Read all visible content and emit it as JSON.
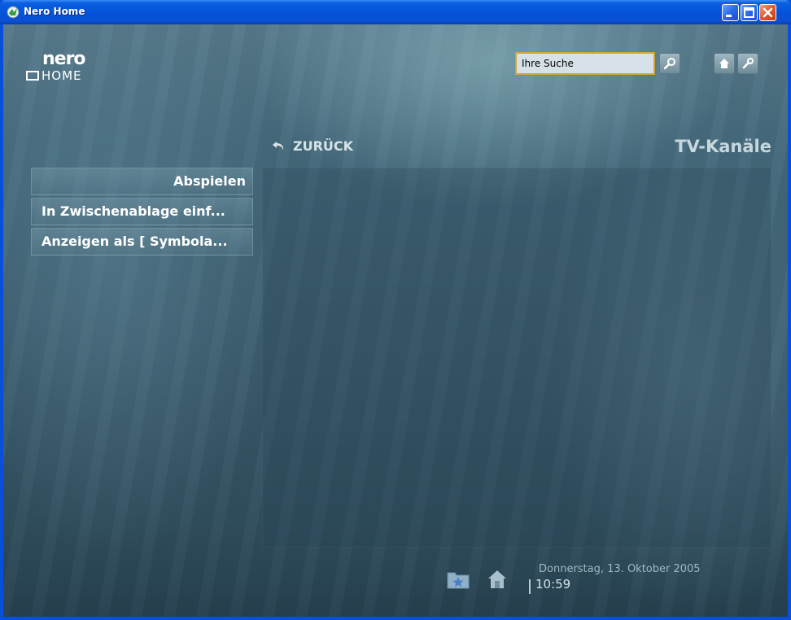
{
  "window": {
    "title": "Nero Home"
  },
  "logo": {
    "top": "nero",
    "bottom": "HOME"
  },
  "search": {
    "value": "Ihre Suche"
  },
  "nav": {
    "back_label": "ZURÜCK",
    "page_title": "TV-Kanäle"
  },
  "menu": {
    "items": [
      {
        "label": "Abspielen"
      },
      {
        "label": "In Zwischenablage einf..."
      },
      {
        "label": "Anzeigen als [ Symbola..."
      }
    ]
  },
  "footer": {
    "date": "Donnerstag, 13. Oktober 2005",
    "time": "10:59"
  },
  "colors": {
    "titlebar": "#0553d9",
    "search_border": "#d4a43a",
    "background": "#3a5b6c"
  },
  "icons": {
    "app": "nero-app-icon",
    "search": "magnifier-icon",
    "home": "home-icon",
    "settings": "wrench-icon",
    "back": "back-arrow-icon",
    "favorites": "favorites-folder-icon"
  }
}
